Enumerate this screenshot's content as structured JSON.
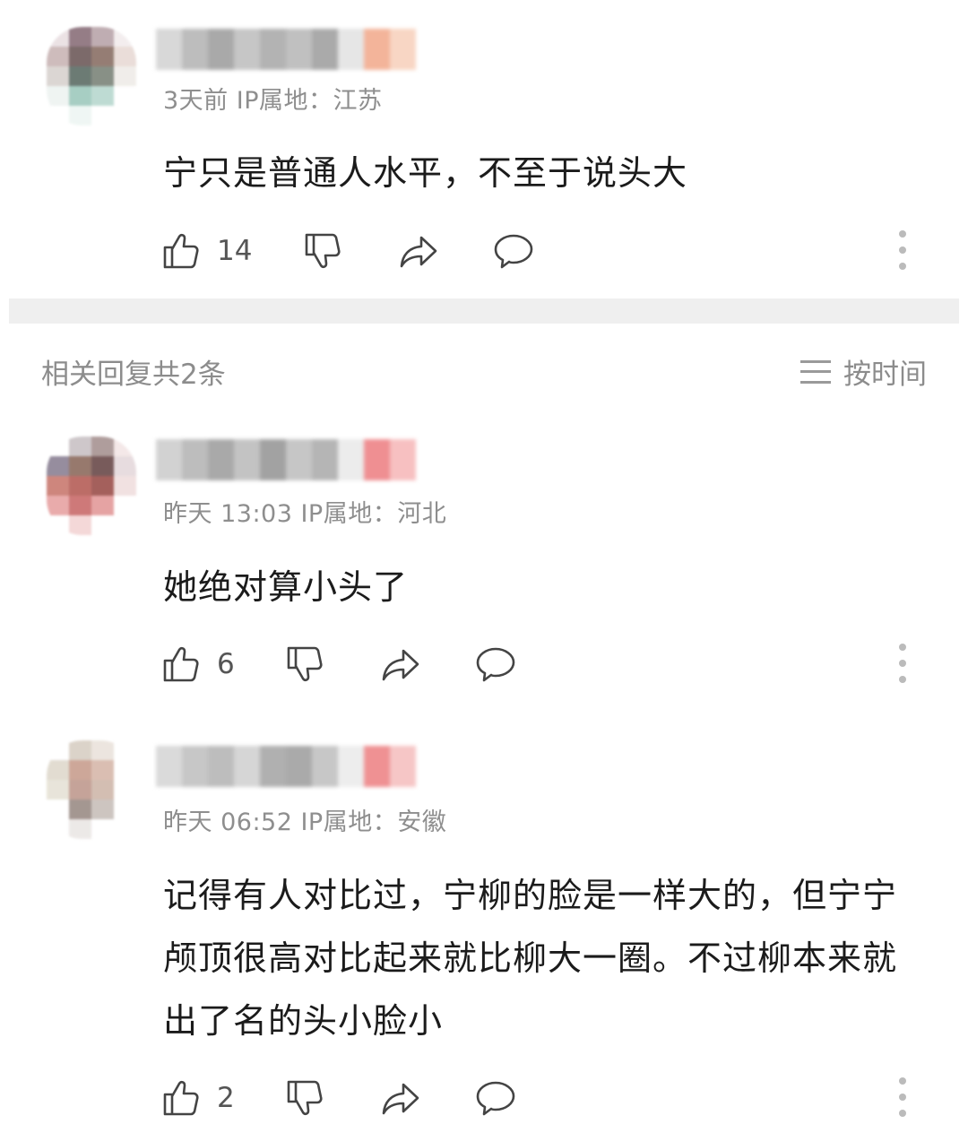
{
  "comments": [
    {
      "meta": "3天前 IP属地：江苏",
      "text": "宁只是普通人水平，不至于说头大",
      "likes": "14"
    },
    {
      "meta": "昨天 13:03 IP属地：河北",
      "text": "她绝对算小头了",
      "likes": "6"
    },
    {
      "meta": "昨天 06:52 IP属地：安徽",
      "text": "记得有人对比过，宁柳的脸是一样大的，但宁宁颅顶很高对比起来就比柳大一圈。不过柳本来就出了名的头小脸小",
      "likes": "2"
    }
  ],
  "replies_header": {
    "title": "相关回复共2条",
    "sort_label": "按时间"
  },
  "icons": [
    "like-icon",
    "dislike-icon",
    "share-icon",
    "reply-icon",
    "more-icon",
    "sort-icon"
  ],
  "colors": {
    "meta": "#8e8e8e",
    "text": "#1b1b1b",
    "divider": "#efefef"
  }
}
